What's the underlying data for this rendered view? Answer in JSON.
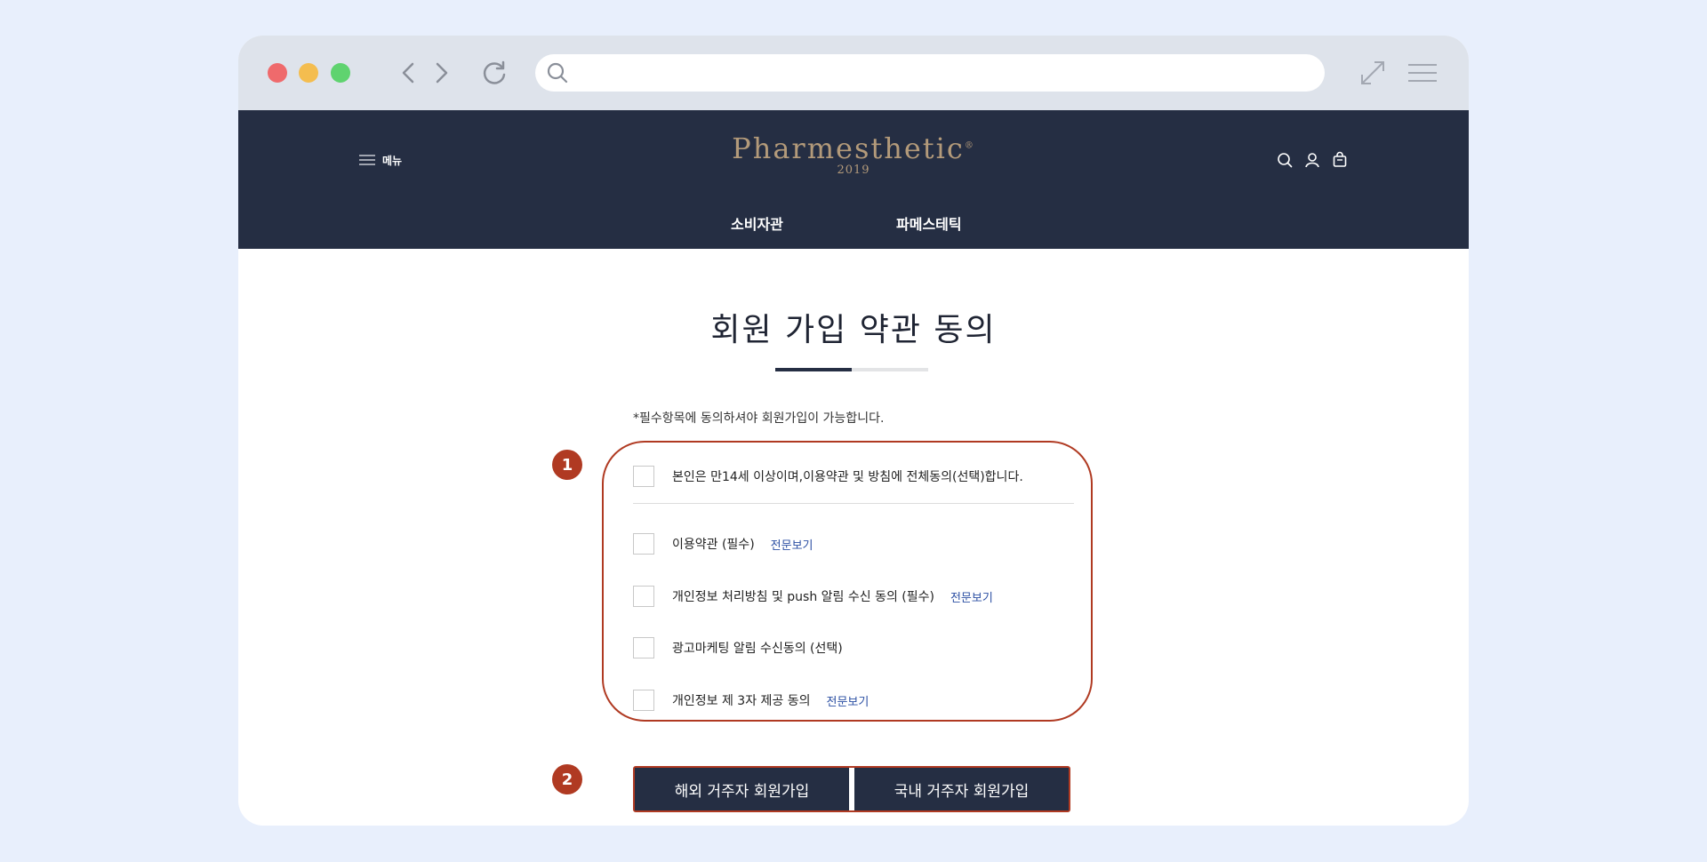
{
  "browser": {
    "address_value": "",
    "address_placeholder": ""
  },
  "header": {
    "menu_label": "메뉴",
    "brand_name": "Pharmesthetic",
    "brand_mark": "®",
    "brand_year": "2019",
    "nav": [
      "소비자관",
      "파메스테틱"
    ]
  },
  "page": {
    "title": "회원 가입 약관 동의",
    "notice": "*필수항목에 동의하셔야 회원가입이 가능합니다.",
    "agree_all": "본인은 만14세 이상이며,이용약관 및 방침에 전체동의(선택)합니다.",
    "terms": [
      {
        "label": "이용약관 (필수)",
        "link": "전문보기"
      },
      {
        "label": "개인정보 처리방침 및 push 알림 수신 동의 (필수)",
        "link": "전문보기"
      },
      {
        "label": "광고마케팅 알림 수신동의 (선택)",
        "link": ""
      },
      {
        "label": "개인정보 제 3자 제공 동의",
        "link": "전문보기"
      }
    ],
    "buttons": {
      "overseas": "해외 거주자 회원가입",
      "domestic": "국내 거주자 회원가입"
    },
    "markers": [
      "1",
      "2"
    ]
  },
  "colors": {
    "navy": "#252e43",
    "accent_red": "#b03a22",
    "brand_gold": "#b39a7a",
    "link_blue": "#2b4fa3"
  }
}
